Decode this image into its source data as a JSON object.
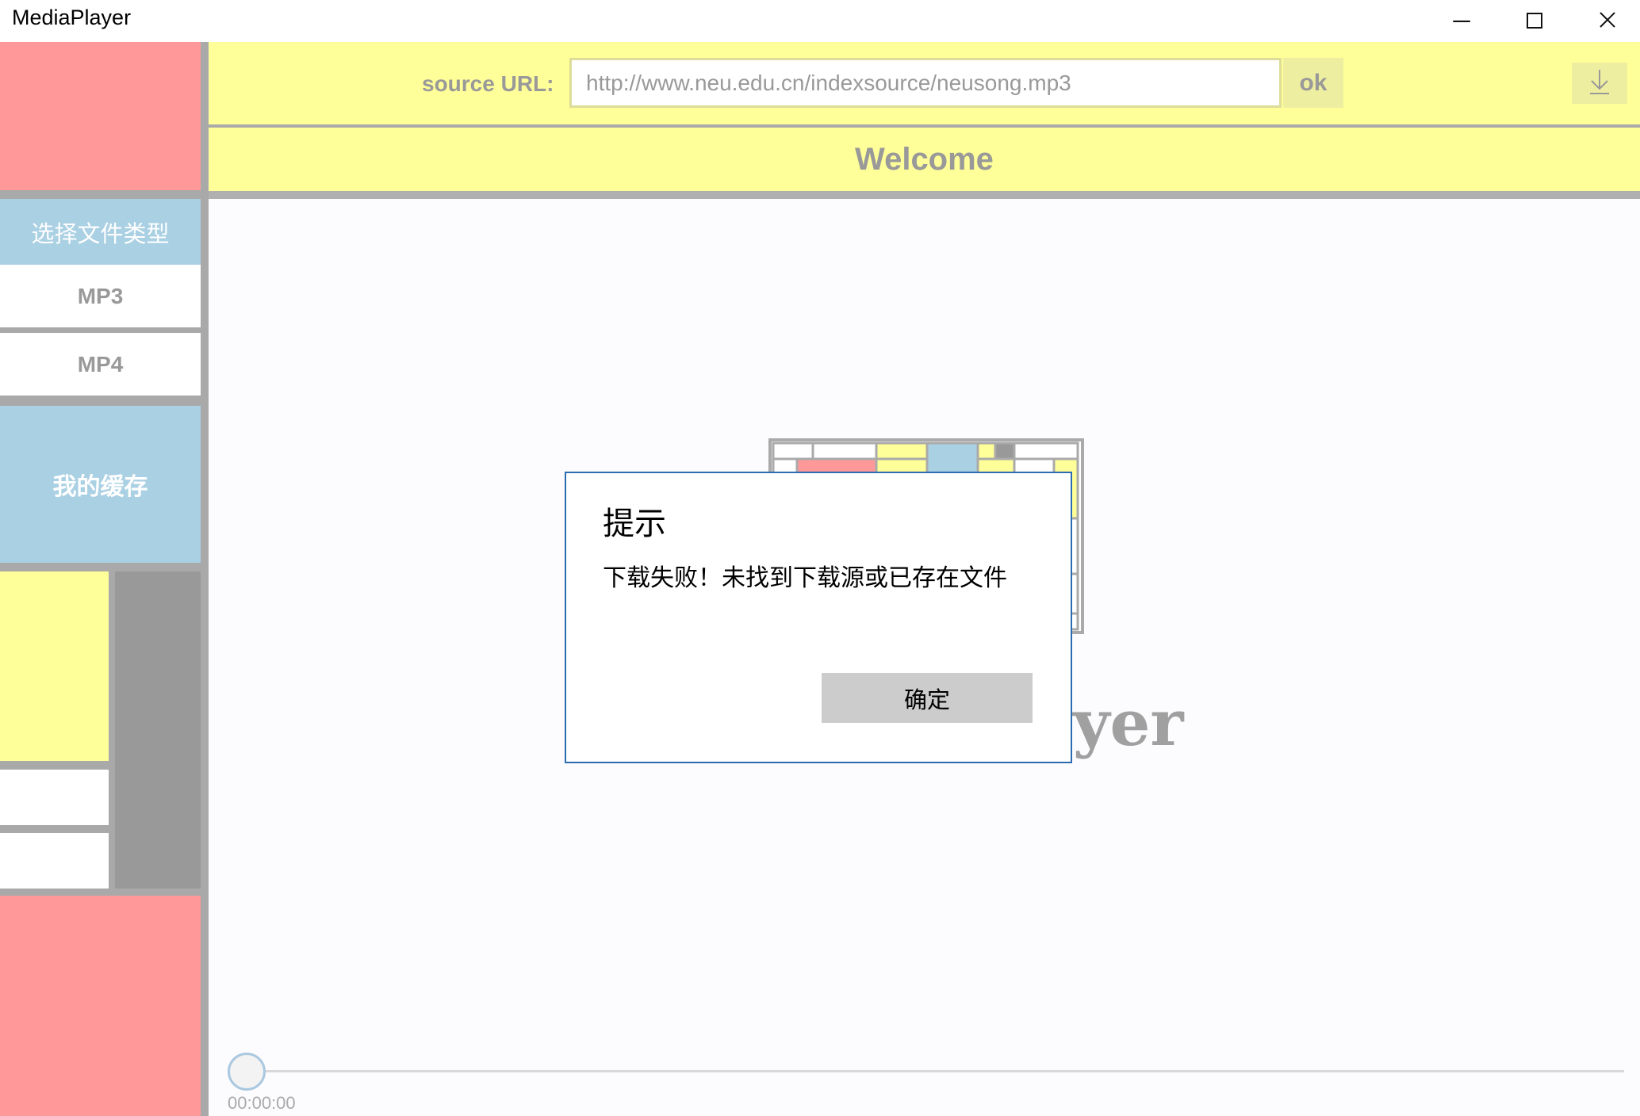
{
  "window": {
    "title": "MediaPlayer",
    "controls": {
      "minimize": "─",
      "maximize": "☐",
      "close": "✕"
    }
  },
  "sidebar": {
    "file_type_header": "选择文件类型",
    "items": [
      {
        "label": "MP3"
      },
      {
        "label": "MP4"
      }
    ],
    "cache_label": "我的缓存"
  },
  "toolbar": {
    "source_label": "source URL:",
    "source_value": "http://www.neu.edu.cn/indexsource/neusong.mp3",
    "ok_label": "ok",
    "download_icon": "download-icon"
  },
  "header": {
    "welcome": "Welcome"
  },
  "logo": {
    "partial_text": "yer"
  },
  "dialog": {
    "title": "提示",
    "message": "下载失败！未找到下载源或已存在文件",
    "confirm_label": "确定"
  },
  "player": {
    "time": "00:00:00",
    "progress": 0
  },
  "colors": {
    "yellow": "#ffff99",
    "red": "#ff9999",
    "blue": "#aad0e3",
    "gray": "#999999",
    "dialog_border": "#2b6cb0"
  }
}
